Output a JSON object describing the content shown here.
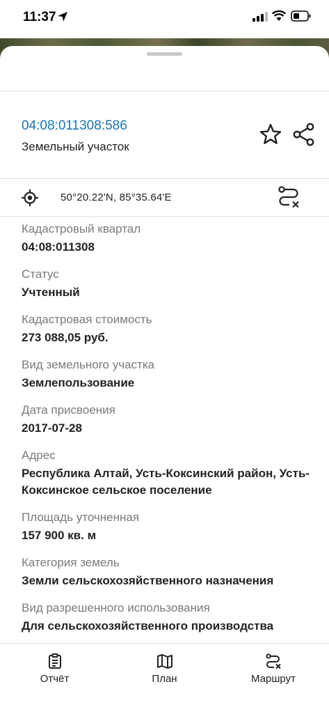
{
  "status_bar": {
    "time": "11:37"
  },
  "header": {
    "cadastral_number": "04:08:011308:586",
    "object_type": "Земельный участок"
  },
  "coordinates": {
    "text": "50°20.22'N, 85°35.64'E"
  },
  "fields": [
    {
      "label": "Кадастровый квартал",
      "value": "04:08:011308"
    },
    {
      "label": "Статус",
      "value": "Учтенный"
    },
    {
      "label": "Кадастровая стоимость",
      "value": "273 088,05 руб."
    },
    {
      "label": "Вид земельного участка",
      "value": "Землепользование"
    },
    {
      "label": "Дата присвоения",
      "value": "2017-07-28"
    },
    {
      "label": "Адрес",
      "value": "Республика Алтай, Усть-Коксинский район, Усть-Коксинское сельское поселение"
    },
    {
      "label": "Площадь уточненная",
      "value": "157 900 кв. м"
    },
    {
      "label": "Категория земель",
      "value": "Земли сельскохозяйственного назначения"
    },
    {
      "label": "Вид разрешенного использования",
      "value": "Для сельскохозяйственного производства"
    }
  ],
  "bottom_nav": {
    "report": "Отчёт",
    "plan": "План",
    "route": "Маршрут"
  },
  "icons": [
    "location-arrow-icon",
    "signal-icon",
    "wifi-icon",
    "battery-icon",
    "star-icon",
    "share-icon",
    "target-icon",
    "route-clear-icon",
    "report-icon",
    "map-icon",
    "route-icon"
  ],
  "colors": {
    "accent": "#1a73b6",
    "label": "#7a7a7a",
    "value": "#222222"
  }
}
